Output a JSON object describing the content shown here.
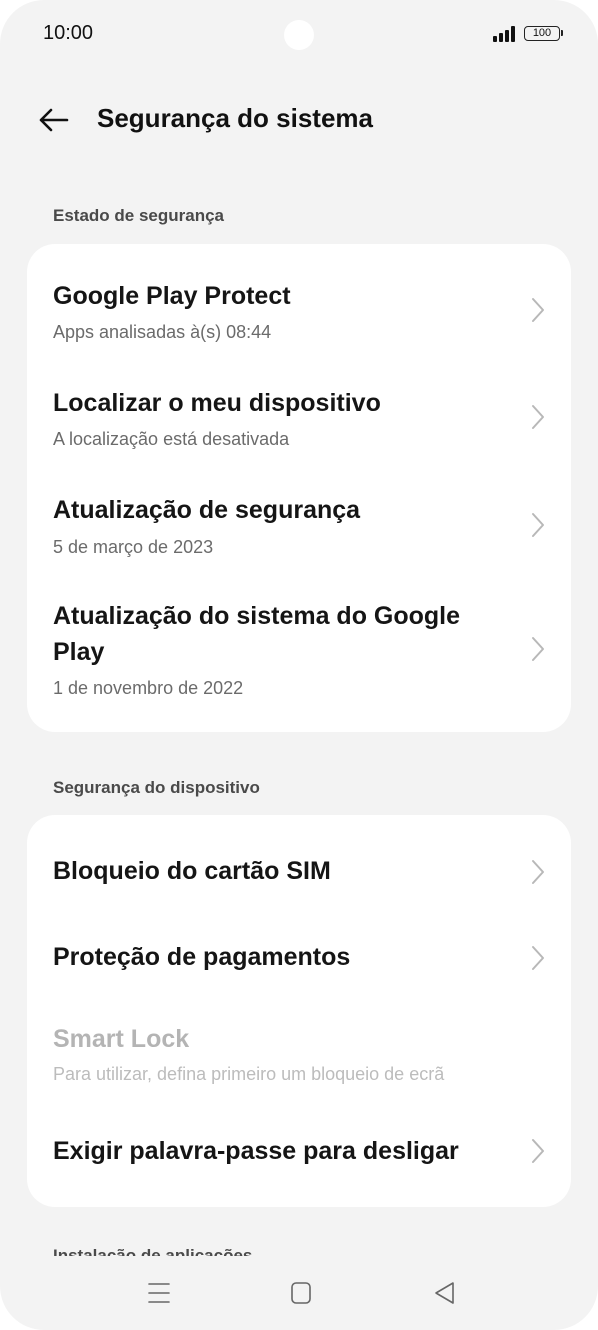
{
  "status_bar": {
    "time": "10:00",
    "battery": "100"
  },
  "header": {
    "title": "Segurança do sistema",
    "back_icon": "arrow-left-icon"
  },
  "sections": [
    {
      "label": "Estado de segurança",
      "items": [
        {
          "title": "Google Play Protect",
          "subtitle": "Apps analisadas à(s) 08:44",
          "enabled": true
        },
        {
          "title": "Localizar o meu dispositivo",
          "subtitle": "A localização está desativada",
          "enabled": true
        },
        {
          "title": "Atualização de segurança",
          "subtitle": "5 de março de 2023",
          "enabled": true
        },
        {
          "title": "Atualização do sistema do Google Play",
          "subtitle": "1 de novembro de 2022",
          "enabled": true
        }
      ]
    },
    {
      "label": "Segurança do dispositivo",
      "items": [
        {
          "title": "Bloqueio do cartão SIM",
          "subtitle": "",
          "enabled": true
        },
        {
          "title": "Proteção de pagamentos",
          "subtitle": "",
          "enabled": true
        },
        {
          "title": "Smart Lock",
          "subtitle": "Para utilizar, defina primeiro um bloqueio de ecrã",
          "enabled": false
        },
        {
          "title": "Exigir palavra-passe para desligar",
          "subtitle": "",
          "enabled": true
        }
      ]
    }
  ],
  "cutoff_section_label": "Instalação de aplicações",
  "nav_bar": {
    "menu_icon": "menu-icon",
    "home_icon": "home-square-icon",
    "back_icon": "back-triangle-icon"
  },
  "colors": {
    "background": "#f3f3f3",
    "card": "#ffffff",
    "title_text": "#151515",
    "subtitle_text": "#6b6b6b",
    "disabled_text": "#b4b4b4"
  }
}
